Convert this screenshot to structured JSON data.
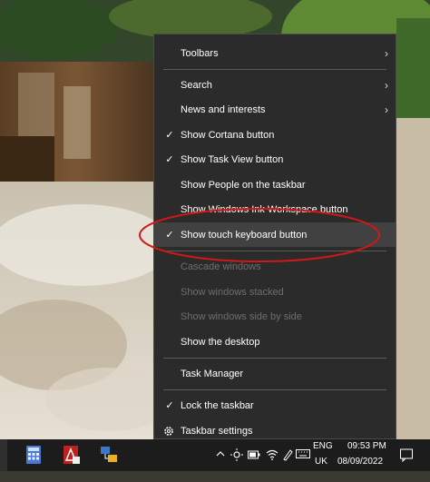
{
  "menu": {
    "items": [
      {
        "label": "Toolbars",
        "submenu": true
      },
      {
        "label": "Search",
        "submenu": true
      },
      {
        "label": "News and interests",
        "submenu": true
      },
      {
        "label": "Show Cortana button",
        "checked": true
      },
      {
        "label": "Show Task View button",
        "checked": true
      },
      {
        "label": "Show People on the taskbar"
      },
      {
        "label": "Show Windows Ink Workspace button"
      },
      {
        "label": "Show touch keyboard button",
        "checked": true,
        "highlighted": true
      },
      {
        "label": "Cascade windows",
        "disabled": true
      },
      {
        "label": "Show windows stacked",
        "disabled": true
      },
      {
        "label": "Show windows side by side",
        "disabled": true
      },
      {
        "label": "Show the desktop"
      },
      {
        "label": "Task Manager"
      },
      {
        "label": "Lock the taskbar",
        "checked": true
      },
      {
        "label": "Taskbar settings",
        "icon": "gear-icon"
      }
    ],
    "check_glyph": "✓",
    "submenu_glyph": "›"
  },
  "taskbar": {
    "apps": [
      "calculator-icon",
      "acrobat-icon",
      "network-app-icon"
    ],
    "tray": {
      "language_top": "ENG",
      "language_bottom": "UK",
      "time": "09:53 PM",
      "date": "08/09/2022",
      "icons": [
        "chevron-up-icon",
        "weather-icon",
        "battery-icon",
        "wifi-icon",
        "pen-icon",
        "keyboard-icon",
        "notification-icon"
      ]
    }
  },
  "colors": {
    "menu_bg": "#2b2b2b",
    "highlight": "#414141",
    "annotation_ellipse": "#d01818",
    "disabled_text": "#6e6e6e"
  }
}
